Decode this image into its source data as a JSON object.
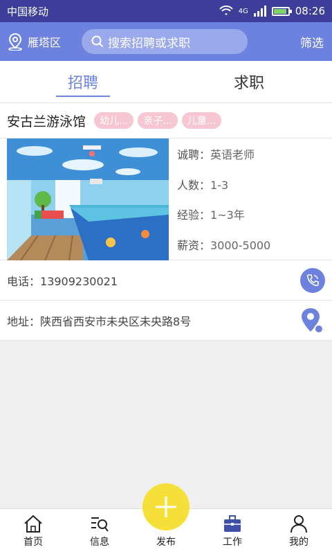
{
  "status": {
    "carrier": "中国移动",
    "time": "08:26",
    "network": "4G"
  },
  "header": {
    "location": "雁塔区",
    "search_placeholder": "搜索招聘或求职",
    "filter_label": "筛选"
  },
  "tabs": [
    {
      "label": "招聘",
      "active": true
    },
    {
      "label": "求职",
      "active": false
    }
  ],
  "listing": {
    "name": "安古兰游泳馆",
    "tags": [
      "幼儿...",
      "亲子...",
      "儿童..."
    ],
    "details": [
      {
        "label": "诚聘：",
        "value": "英语老师"
      },
      {
        "label": "人数：",
        "value": "1-3"
      },
      {
        "label": "经验：",
        "value": "1~3年"
      },
      {
        "label": "薪资：",
        "value": "3000-5000"
      }
    ],
    "phone_label": "电话：",
    "phone": "13909230021",
    "address_label": "地址：",
    "address": "陕西省西安市未央区未央路8号"
  },
  "bottom_nav": [
    {
      "label": "首页",
      "icon": "home-icon"
    },
    {
      "label": "信息",
      "icon": "search-list-icon"
    },
    {
      "label": "发布",
      "icon": "plus-icon"
    },
    {
      "label": "工作",
      "icon": "briefcase-icon"
    },
    {
      "label": "我的",
      "icon": "user-icon"
    }
  ],
  "colors": {
    "primary": "#6d81de",
    "status_bar": "#3d3e9a",
    "tag": "#f6c7d3",
    "fab": "#f6df38",
    "active_nav": "#3d4fa8"
  }
}
